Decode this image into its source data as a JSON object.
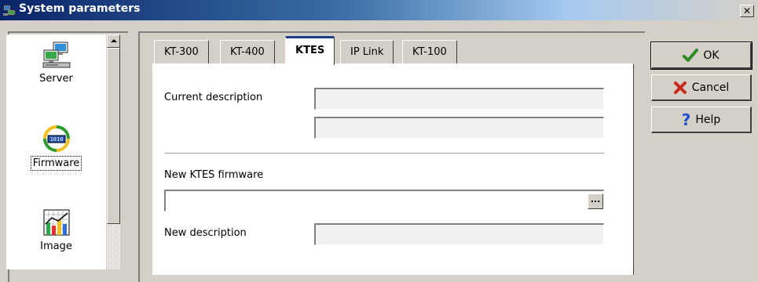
{
  "window": {
    "title": "System parameters",
    "close_label": "✕",
    "title_icon": "system-parameters-icon"
  },
  "sidebar": {
    "items": [
      {
        "label": "Server",
        "icon": "server-computers-icon",
        "active": false
      },
      {
        "label": "Firmware",
        "icon": "firmware-chip-icon",
        "active": true
      },
      {
        "label": "Image",
        "icon": "bar-chart-image-icon",
        "active": false
      }
    ]
  },
  "tabs": [
    {
      "label": "KT-300",
      "active": false
    },
    {
      "label": "KT-400",
      "active": false
    },
    {
      "label": "KTES",
      "active": true
    },
    {
      "label": "IP Link",
      "active": false
    },
    {
      "label": "KT-100",
      "active": false
    }
  ],
  "form": {
    "current_description_label": "Current description",
    "current_description_value": "",
    "current_description_value2": "",
    "new_firmware_label": "New KTES firmware",
    "new_firmware_value": "",
    "browse_label": "...",
    "new_description_label": "New description",
    "new_description_value": ""
  },
  "buttons": {
    "ok_label": "OK",
    "ok_icon": "checkmark-icon",
    "cancel_label": "Cancel",
    "cancel_icon": "red-x-icon",
    "help_label": "Help",
    "help_icon": "question-mark-icon"
  },
  "colors": {
    "ok_icon": "#2e8b22",
    "cancel_icon": "#c8281e",
    "help_icon": "#1f4fd0",
    "active_tab_accent": "#1c3a8a"
  }
}
